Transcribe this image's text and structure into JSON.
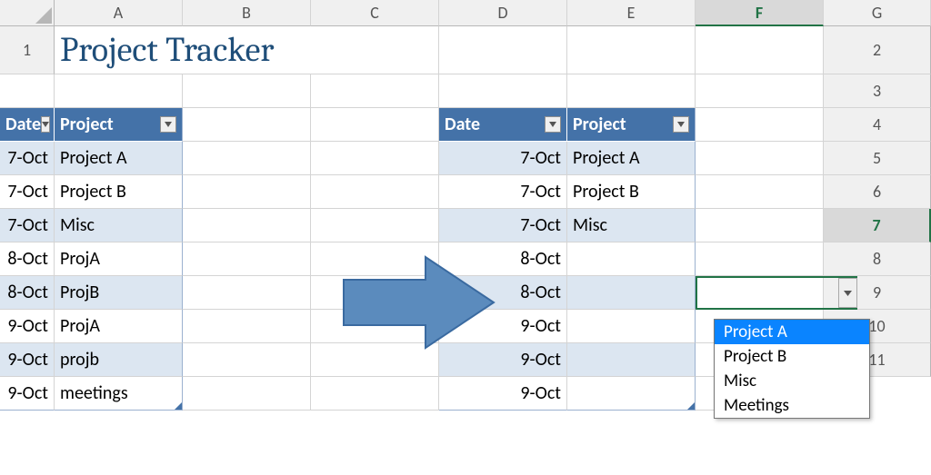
{
  "columns": [
    "A",
    "B",
    "C",
    "D",
    "E",
    "F",
    "G"
  ],
  "rows": [
    "1",
    "2",
    "3",
    "4",
    "5",
    "6",
    "7",
    "8",
    "9",
    "10",
    "11"
  ],
  "title": "Project Tracker",
  "table_left": {
    "headers": {
      "date": "Date",
      "project": "Project"
    },
    "rows": [
      {
        "date": "7-Oct",
        "project": "Project A"
      },
      {
        "date": "7-Oct",
        "project": "Project B"
      },
      {
        "date": "7-Oct",
        "project": "Misc"
      },
      {
        "date": "8-Oct",
        "project": "ProjA"
      },
      {
        "date": "8-Oct",
        "project": "ProjB"
      },
      {
        "date": "9-Oct",
        "project": "ProjA"
      },
      {
        "date": "9-Oct",
        "project": "projb"
      },
      {
        "date": "9-Oct",
        "project": "meetings"
      }
    ]
  },
  "table_right": {
    "headers": {
      "date": "Date",
      "project": "Project"
    },
    "rows": [
      {
        "date": "7-Oct",
        "project": "Project A"
      },
      {
        "date": "7-Oct",
        "project": "Project B"
      },
      {
        "date": "7-Oct",
        "project": "Misc"
      },
      {
        "date": "8-Oct",
        "project": ""
      },
      {
        "date": "8-Oct",
        "project": ""
      },
      {
        "date": "9-Oct",
        "project": ""
      },
      {
        "date": "9-Oct",
        "project": ""
      },
      {
        "date": "9-Oct",
        "project": ""
      }
    ]
  },
  "dropdown": {
    "options": [
      "Project A",
      "Project B",
      "Misc",
      "Meetings"
    ],
    "highlighted": 0
  },
  "active_cell": "F7",
  "selected_row": "7",
  "selected_col": "F",
  "colors": {
    "accent": "#4472a8",
    "band": "#dce6f1",
    "selection": "#217346",
    "title": "#1f4e79"
  }
}
